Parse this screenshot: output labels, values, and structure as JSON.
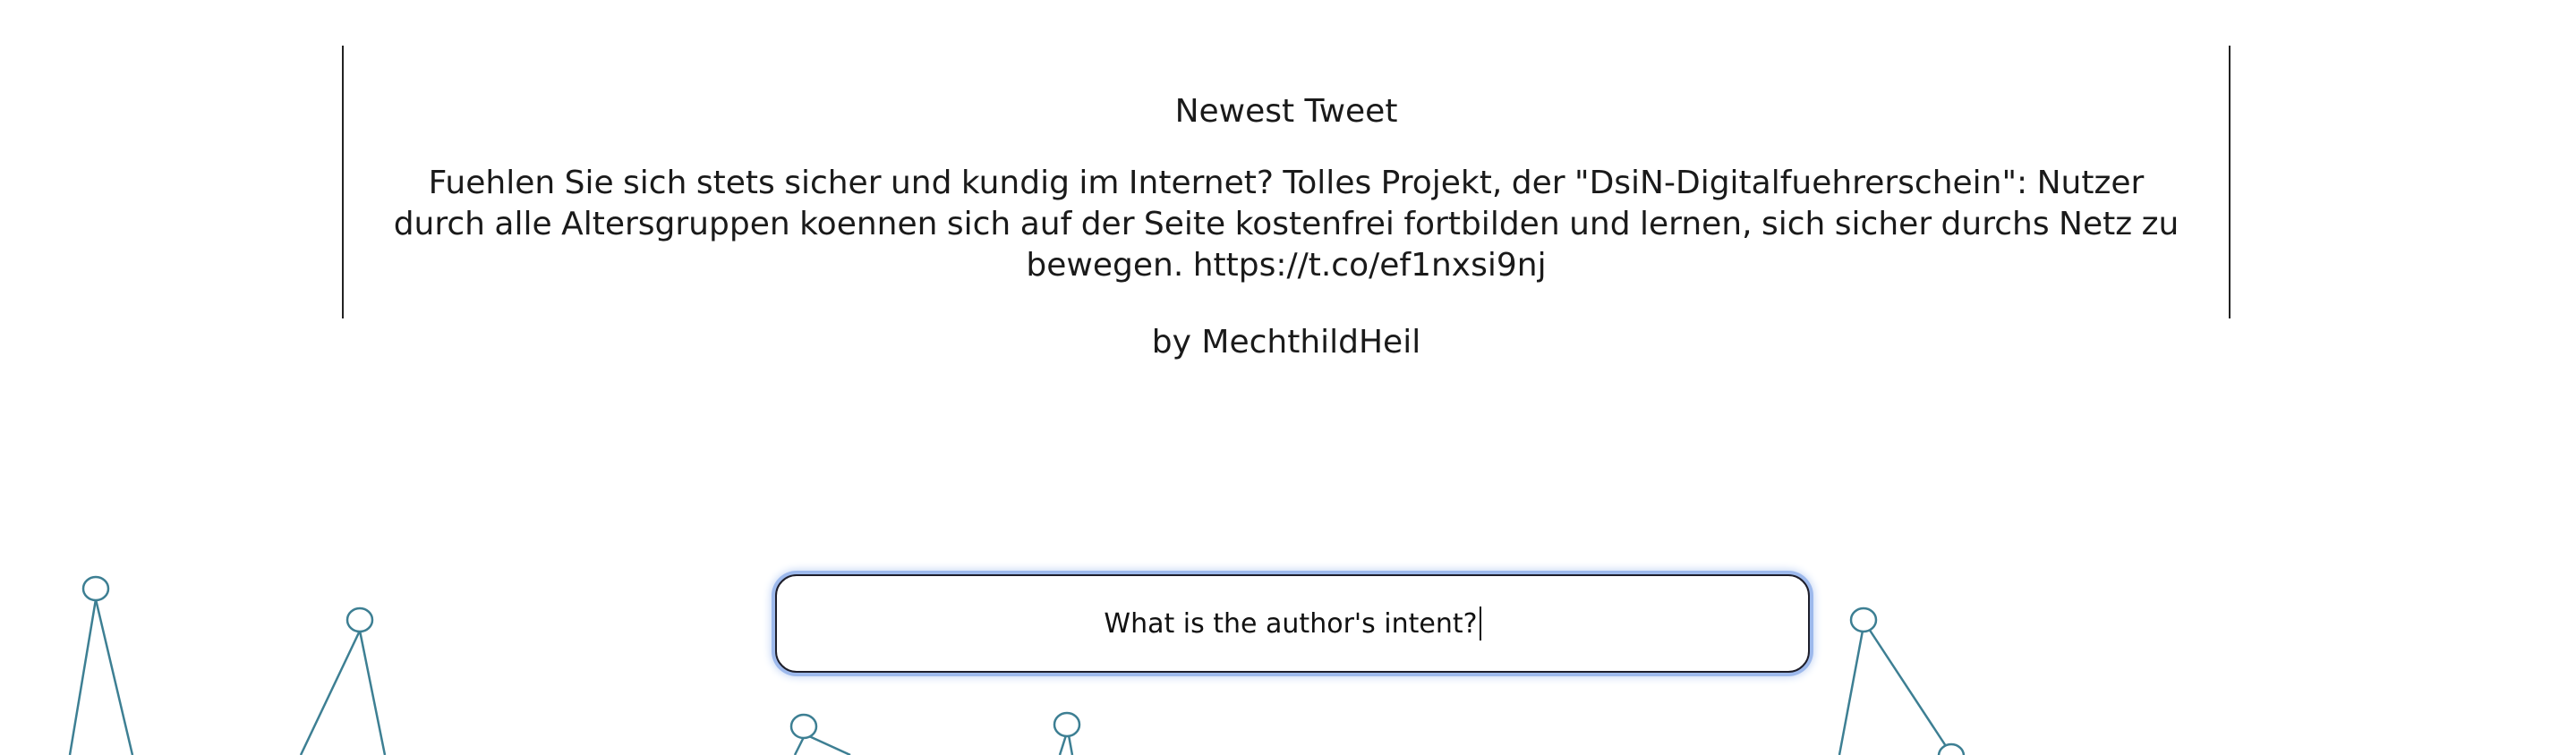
{
  "tweet": {
    "heading": "Newest Tweet",
    "text": "Fuehlen Sie sich stets sicher und kundig im Internet? Tolles Projekt, der \"DsiN-Digitalfuehrerschein\": Nutzer durch alle Altersgruppen koennen sich auf der Seite kostenfrei fortbilden und lernen, sich sicher durchs Netz zu bewegen. https://t.co/ef1nxsi9nj",
    "author": "by MechthildHeil"
  },
  "question": {
    "value": "What is the author's intent?"
  },
  "colors": {
    "decor_stroke": "#3d7f93",
    "focus_ring": "#9db9ec",
    "panel_border": "#222222"
  }
}
